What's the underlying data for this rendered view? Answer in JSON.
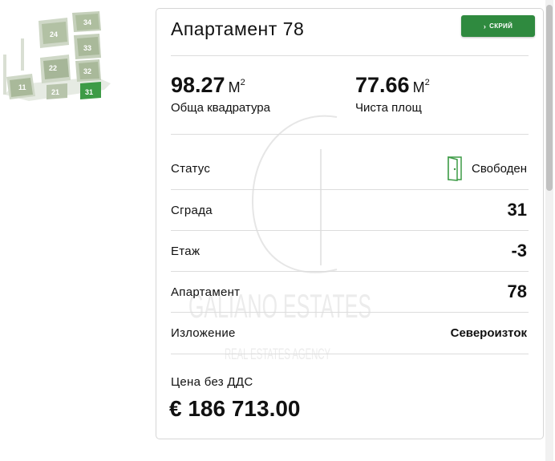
{
  "site_map": {
    "buildings": [
      "24",
      "34",
      "33",
      "22",
      "32",
      "11",
      "21",
      "31"
    ],
    "selected": "31",
    "selected_color": "#3d9b46"
  },
  "card": {
    "title": "Апартамент 78",
    "hide_button_label": "СКРИЙ",
    "total_area": {
      "value": "98.27",
      "unit": "М",
      "unit_sup": "2",
      "label": "Обща квадратура"
    },
    "net_area": {
      "value": "77.66",
      "unit": "М",
      "unit_sup": "2",
      "label": "Чиста площ"
    },
    "rows": [
      {
        "label": "Статус",
        "value": "Свободен"
      },
      {
        "label": "Сграда",
        "value": "31"
      },
      {
        "label": "Етаж",
        "value": "-3"
      },
      {
        "label": "Апартамент",
        "value": "78"
      },
      {
        "label": "Изложение",
        "value": "Североизток"
      }
    ],
    "price_label": "Цена без ДДС",
    "price": "€ 186 713.00"
  },
  "watermark": {
    "brand": "GALIANO ESTATES",
    "tagline": "REAL ESTATES AGENCY"
  },
  "colors": {
    "accent": "#2f8a3f",
    "status_icon": "#3d9b46"
  }
}
